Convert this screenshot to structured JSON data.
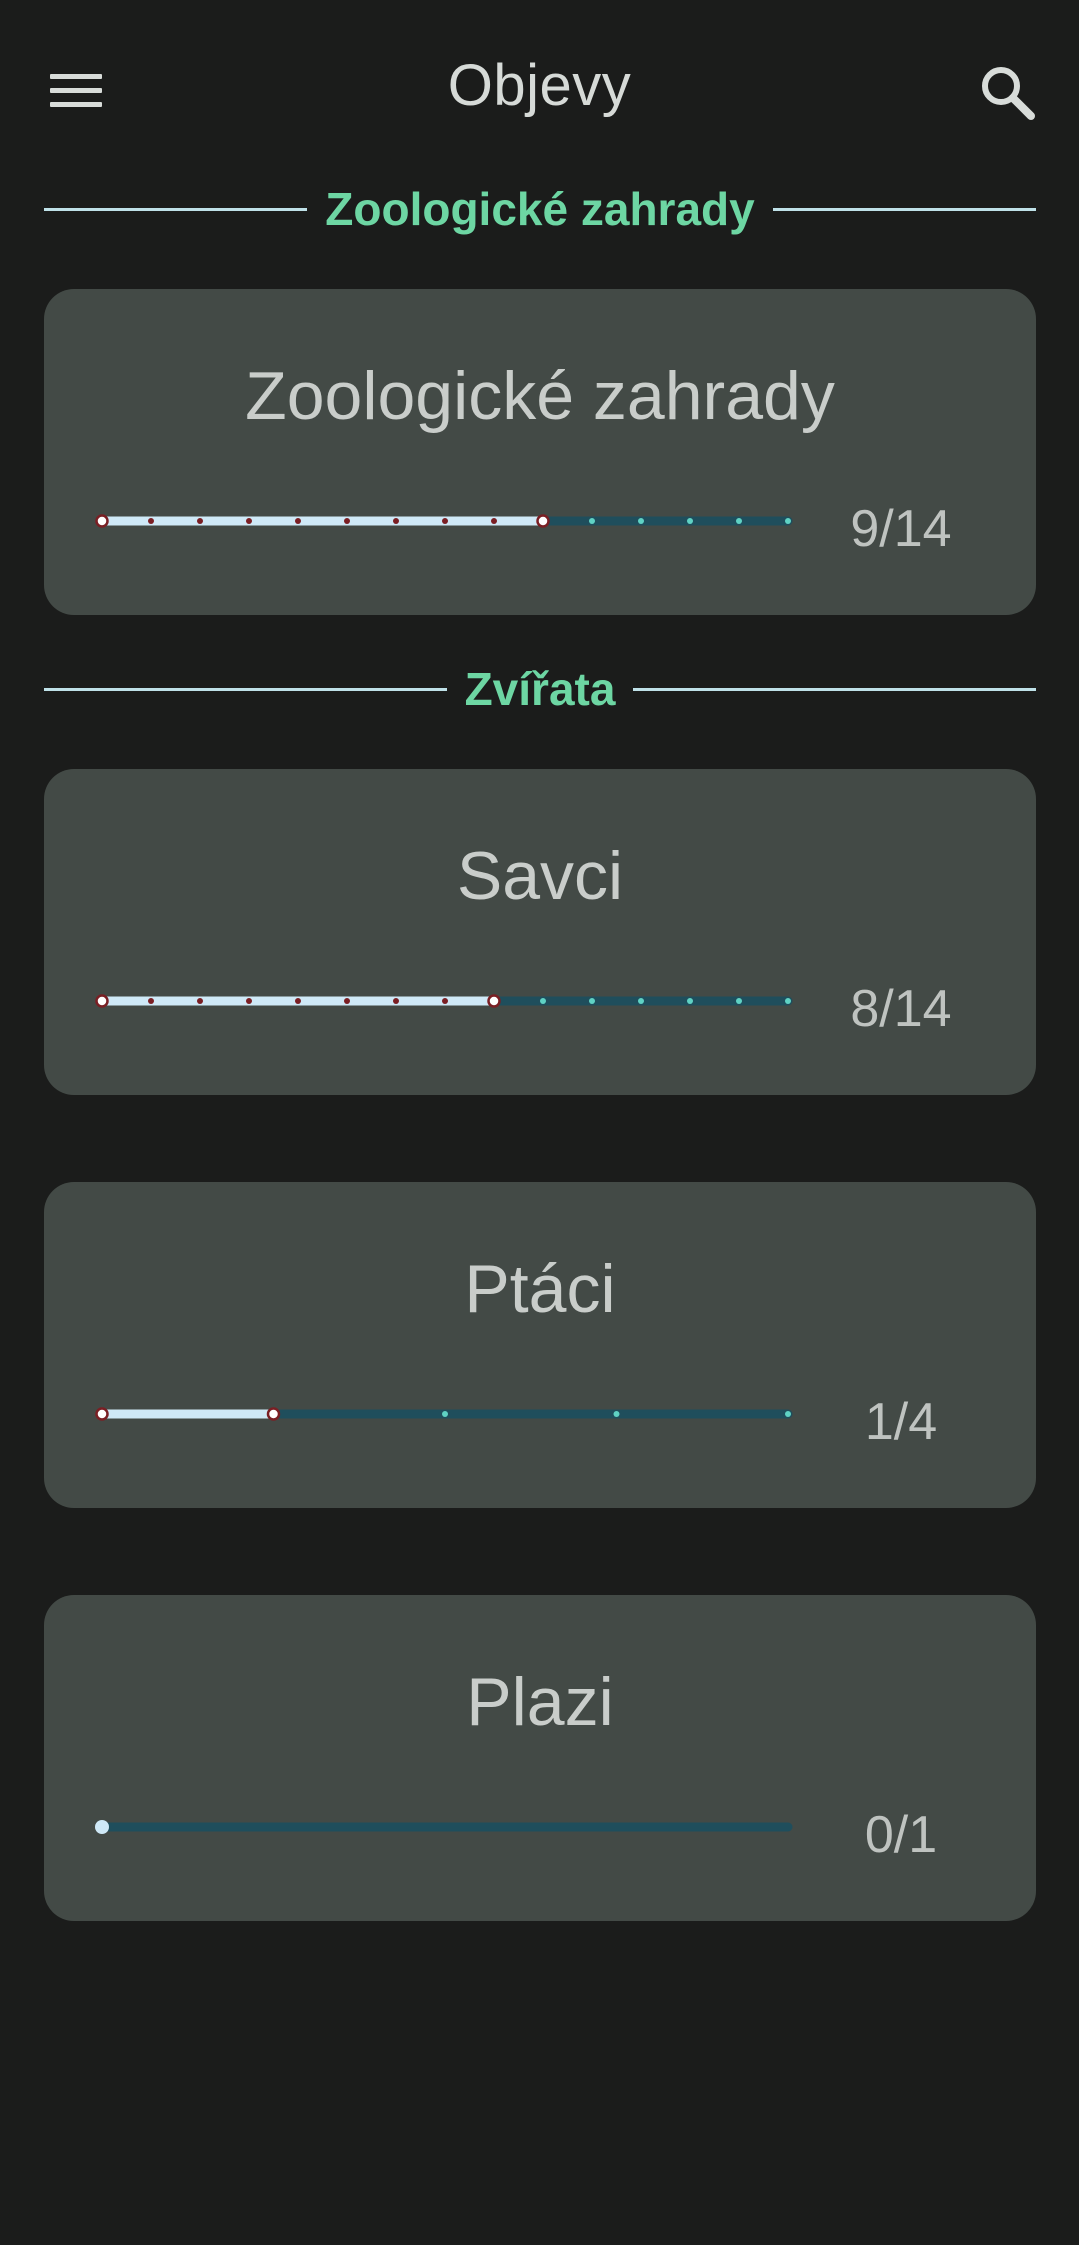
{
  "appbar": {
    "title": "Objevy",
    "menu_icon": "menu-icon",
    "search_icon": "search-icon"
  },
  "sections": [
    {
      "label": "Zoologické zahrady",
      "cards": [
        {
          "title": "Zoologické zahrady",
          "count_label": "9/14",
          "found": 9,
          "total": 14
        }
      ]
    },
    {
      "label": "Zvířata",
      "cards": [
        {
          "title": "Savci",
          "count_label": "8/14",
          "found": 8,
          "total": 14
        },
        {
          "title": "Ptáci",
          "count_label": "1/4",
          "found": 1,
          "total": 4
        },
        {
          "title": "Plazi",
          "count_label": "0/1",
          "found": 0,
          "total": 1
        }
      ]
    }
  ],
  "colors": {
    "background": "#1b1c1b",
    "card": "#434a46",
    "accent": "#6dd6a3",
    "progress_filled": "#cfe9f7",
    "progress_track": "#1f4e5c",
    "tick_filled": "#7a1f24",
    "tick_empty": "#5fd2c4"
  }
}
